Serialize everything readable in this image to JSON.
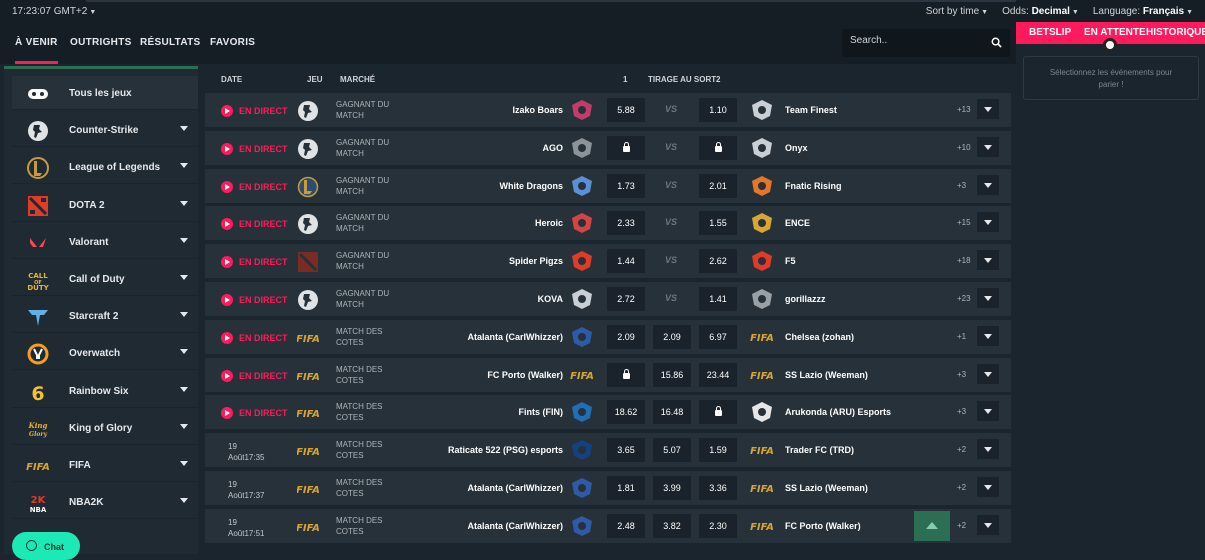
{
  "topbar": {
    "time": "17:23:07 GMT+2",
    "sort_label": "Sort by time",
    "odds_label": "Odds:",
    "odds_value": "Decimal",
    "language_label": "Language:",
    "language_value": "Français"
  },
  "tabs": [
    "À VENIR",
    "OUTRIGHTS",
    "RÉSULTATS",
    "FAVORIS"
  ],
  "search": {
    "placeholder": "Search.."
  },
  "games": [
    {
      "label": "Tous les jeux",
      "icon": "gamepad-icon"
    },
    {
      "label": "Counter-Strike",
      "icon": "counter-strike-icon"
    },
    {
      "label": "League of Legends",
      "icon": "league-of-legends-icon"
    },
    {
      "label": "DOTA 2",
      "icon": "dota2-icon"
    },
    {
      "label": "Valorant",
      "icon": "valorant-icon"
    },
    {
      "label": "Call of Duty",
      "icon": "call-of-duty-icon"
    },
    {
      "label": "Starcraft 2",
      "icon": "starcraft-icon"
    },
    {
      "label": "Overwatch",
      "icon": "overwatch-icon"
    },
    {
      "label": "Rainbow Six",
      "icon": "rainbow-six-icon"
    },
    {
      "label": "King of Glory",
      "icon": "king-of-glory-icon"
    },
    {
      "label": "FIFA",
      "icon": "fifa-icon"
    },
    {
      "label": "NBA2K",
      "icon": "nba2k-icon"
    }
  ],
  "table_headers": {
    "date": "DATE",
    "game": "JEU",
    "market": "MARCHÉ",
    "one": "1",
    "draw": "TIRAGE AU SORT",
    "two": "2"
  },
  "live_label": "EN DIRECT",
  "rows": [
    {
      "live": true,
      "game": "cs",
      "market": "GAGNANT DU MATCH",
      "team1": "Izako Boars",
      "odd1": "5.88",
      "draw": "VS",
      "odd2": "1.10",
      "team2": "Team Finest",
      "more": "+13"
    },
    {
      "live": true,
      "game": "cs",
      "market": "GAGNANT DU MATCH",
      "team1": "AGO",
      "odd1": "lock",
      "draw": "VS",
      "odd2": "lock",
      "team2": "Onyx",
      "more": "+10"
    },
    {
      "live": true,
      "game": "lol",
      "market": "GAGNANT DU MATCH",
      "team1": "White Dragons",
      "odd1": "1.73",
      "draw": "VS",
      "odd2": "2.01",
      "team2": "Fnatic Rising",
      "more": "+3"
    },
    {
      "live": true,
      "game": "cs",
      "market": "GAGNANT DU MATCH",
      "team1": "Heroic",
      "odd1": "2.33",
      "draw": "VS",
      "odd2": "1.55",
      "team2": "ENCE",
      "more": "+15"
    },
    {
      "live": true,
      "game": "dota",
      "market": "GAGNANT DU MATCH",
      "team1": "Spider Pigzs",
      "odd1": "1.44",
      "draw": "VS",
      "odd2": "2.62",
      "team2": "F5",
      "more": "+18"
    },
    {
      "live": true,
      "game": "cs",
      "market": "GAGNANT DU MATCH",
      "team1": "KOVA",
      "odd1": "2.72",
      "draw": "VS",
      "odd2": "1.41",
      "team2": "gorillazzz",
      "more": "+23"
    },
    {
      "live": true,
      "game": "fifa",
      "market": "MATCH DES COTES",
      "team1": "Atalanta (CarlWhizzer)",
      "odd1": "2.09",
      "draw": "2.09",
      "odd2": "6.97",
      "team2": "Chelsea (zohan)",
      "more": "+1"
    },
    {
      "live": true,
      "game": "fifa",
      "market": "MATCH DES COTES",
      "team1": "FC Porto (Walker)",
      "odd1": "lock",
      "draw": "15.86",
      "odd2": "23.44",
      "team2": "SS Lazio (Weeman)",
      "more": "+3"
    },
    {
      "live": true,
      "game": "fifa",
      "market": "MATCH DES COTES",
      "team1": "Fints (FIN)",
      "odd1": "18.62",
      "draw": "16.48",
      "odd2": "lock",
      "team2": "Arukonda (ARU) Esports",
      "more": "+3"
    },
    {
      "live": false,
      "date1": "19",
      "date2": "Août17:35",
      "game": "fifa",
      "market": "MATCH DES COTES",
      "team1": "Raticate 522 (PSG) esports",
      "odd1": "3.65",
      "draw": "5.07",
      "odd2": "1.59",
      "team2": "Trader FC (TRD)",
      "more": "+2"
    },
    {
      "live": false,
      "date1": "19",
      "date2": "Août17:37",
      "game": "fifa",
      "market": "MATCH DES COTES",
      "team1": "Atalanta (CarlWhizzer)",
      "odd1": "1.81",
      "draw": "3.99",
      "odd2": "3.36",
      "team2": "SS Lazio (Weeman)",
      "more": "+2"
    },
    {
      "live": false,
      "date1": "19",
      "date2": "Août17:51",
      "game": "fifa",
      "market": "MATCH DES COTES",
      "team1": "Atalanta (CarlWhizzer)",
      "odd1": "2.48",
      "draw": "3.82",
      "odd2": "2.30",
      "team2": "FC Porto (Walker)",
      "more": "+2"
    }
  ],
  "fifa_text": "FIFA",
  "betslip": {
    "tabs": [
      "BETSLIP",
      "EN ATTENTE",
      "HISTORIQUE"
    ],
    "empty_message": "Sélectionnez les événements pour parier !"
  },
  "chat": {
    "label": "Chat"
  },
  "colors": {
    "accent": "#ff1a5c",
    "green": "#2b6e54",
    "chat": "#1de9b6",
    "fifa": "#d8a532"
  }
}
